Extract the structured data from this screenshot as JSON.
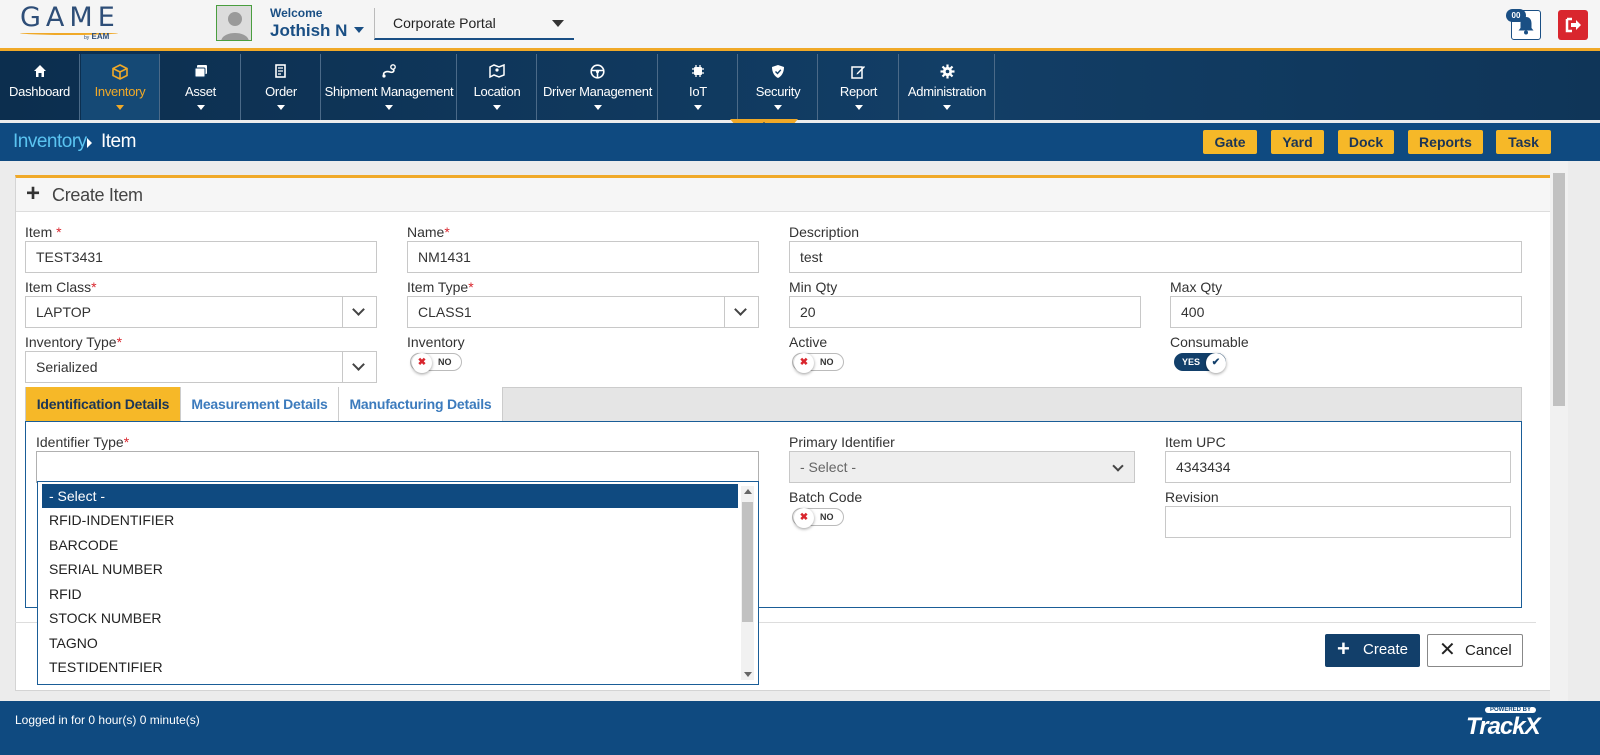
{
  "header": {
    "logo_text": "GAME",
    "logo_sub_by": "by",
    "logo_sub": "EAM",
    "welcome_label": "Welcome",
    "user_name": "Jothish N",
    "portal_selected": "Corporate Portal",
    "notification_count": "00"
  },
  "nav": {
    "items": [
      {
        "label": "Dashboard",
        "icon": "home-icon"
      },
      {
        "label": "Inventory",
        "icon": "cube-icon",
        "active": true
      },
      {
        "label": "Asset",
        "icon": "asset-icon"
      },
      {
        "label": "Order",
        "icon": "order-icon"
      },
      {
        "label": "Shipment Management",
        "icon": "shipment-icon"
      },
      {
        "label": "Location",
        "icon": "map-icon"
      },
      {
        "label": "Driver Management",
        "icon": "steering-wheel-icon"
      },
      {
        "label": "IoT",
        "icon": "iot-chip-icon"
      },
      {
        "label": "Security",
        "icon": "shield-icon"
      },
      {
        "label": "Report",
        "icon": "report-edit-icon"
      },
      {
        "label": "Administration",
        "icon": "gear-icon"
      }
    ]
  },
  "breadcrumb": {
    "parent": "Inventory",
    "current": "Item"
  },
  "quick_buttons": [
    "Gate",
    "Yard",
    "Dock",
    "Reports",
    "Task"
  ],
  "panel": {
    "title": "Create Item"
  },
  "form": {
    "item": {
      "label": "Item ",
      "required": "*",
      "value": "TEST3431"
    },
    "name": {
      "label": "Name",
      "required": "*",
      "value": "NM1431"
    },
    "description": {
      "label": "Description",
      "value": "test"
    },
    "item_class": {
      "label": "Item Class",
      "required": "*",
      "value": "LAPTOP"
    },
    "item_type": {
      "label": "Item Type",
      "required": "*",
      "value": "CLASS1"
    },
    "min_qty": {
      "label": "Min Qty",
      "value": "20"
    },
    "max_qty": {
      "label": "Max Qty",
      "value": "400"
    },
    "inventory_type": {
      "label": "Inventory Type",
      "required": "*",
      "value": "Serialized"
    },
    "inventory": {
      "label": "Inventory",
      "state": "NO"
    },
    "active": {
      "label": "Active",
      "state": "NO"
    },
    "consumable": {
      "label": "Consumable",
      "state": "YES"
    }
  },
  "tabs": [
    {
      "label": "Identification Details",
      "active": true
    },
    {
      "label": "Measurement Details"
    },
    {
      "label": "Manufacturing Details"
    }
  ],
  "identification": {
    "identifier_type": {
      "label": "Identifier Type",
      "required": "*",
      "value": ""
    },
    "primary_identifier": {
      "label": "Primary Identifier",
      "placeholder": "- Select -"
    },
    "item_upc": {
      "label": "Item UPC",
      "value": "4343434"
    },
    "batch_code": {
      "label": "Batch Code",
      "state": "NO"
    },
    "revision": {
      "label": "Revision",
      "value": ""
    }
  },
  "identifier_dropdown": {
    "options": [
      "- Select -",
      "RFID-INDENTIFIER",
      "BARCODE",
      "SERIAL NUMBER",
      "RFID",
      "STOCK NUMBER",
      "TAGNO",
      "TESTIDENTIFIER"
    ],
    "selected_index": 0
  },
  "actions": {
    "create_label": "Create",
    "cancel_label": "Cancel"
  },
  "status": {
    "logged_in": "Logged in for 0 hour(s) 0 minute(s)",
    "powered_by": "POWERED BY",
    "brand": "TrackX"
  },
  "colors": {
    "navy": "#0f4a80",
    "accent": "#f0a928",
    "button_yellow": "#f6b828",
    "danger": "#d9262e"
  }
}
